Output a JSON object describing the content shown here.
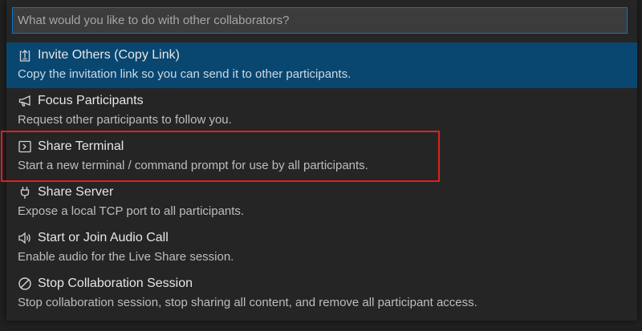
{
  "quick_pick": {
    "placeholder": "What would you like to do with other collaborators?",
    "value": "",
    "items": [
      {
        "icon": "share-link-icon",
        "label": "Invite Others (Copy Link)",
        "description": "Copy the invitation link so you can send it to other participants.",
        "selected": true
      },
      {
        "icon": "megaphone-icon",
        "label": "Focus Participants",
        "description": "Request other participants to follow you.",
        "selected": false
      },
      {
        "icon": "terminal-icon",
        "label": "Share Terminal",
        "description": "Start a new terminal / command prompt for use by all participants.",
        "selected": false,
        "annotated": true
      },
      {
        "icon": "plug-icon",
        "label": "Share Server",
        "description": "Expose a local TCP port to all participants.",
        "selected": false
      },
      {
        "icon": "speaker-icon",
        "label": "Start or Join Audio Call",
        "description": "Enable audio for the Live Share session.",
        "selected": false
      },
      {
        "icon": "stop-circle-icon",
        "label": "Stop Collaboration Session",
        "description": "Stop collaboration session, stop sharing all content, and remove all participant access.",
        "selected": false
      }
    ]
  },
  "colors": {
    "selected_background": "#094771",
    "focus_border": "#007acc",
    "annotation_border": "#e01f1f"
  }
}
